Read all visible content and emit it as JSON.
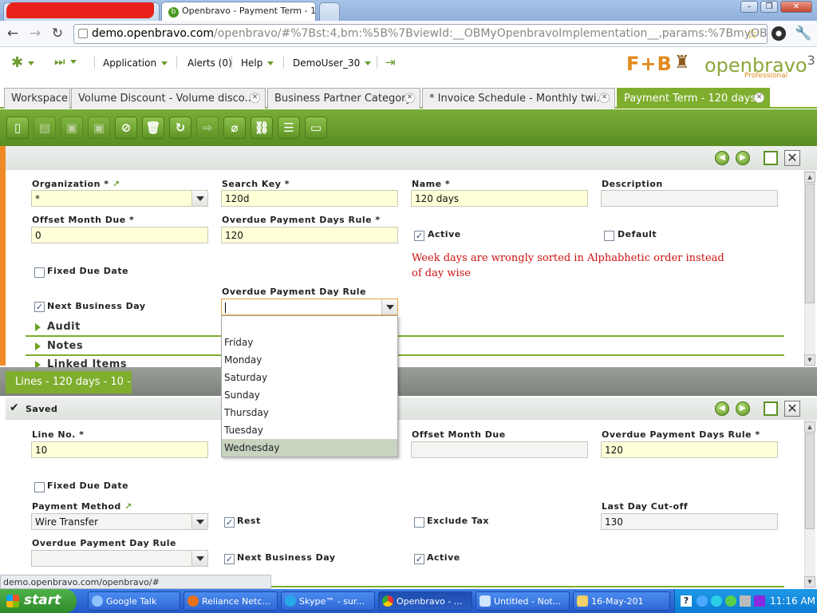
{
  "browser": {
    "active_tab_title": "Openbravo - Payment Term - 1",
    "url_host": "demo.openbravo.com",
    "url_rest": "/openbravo/#%7Bst:4,bm:%5B%7BviewId:__OBMyOpenbravoImplementation__,params:%7BmyOB:true,car"
  },
  "app_menu": {
    "application": "Application",
    "alerts": "Alerts (0)",
    "help": "Help",
    "user": "DemoUser_30"
  },
  "logo": {
    "brand1": "F+B",
    "brand2": "openbravo",
    "brand_sup": "3",
    "brand_sub": "Professional"
  },
  "app_tabs": [
    {
      "label": "Workspace"
    },
    {
      "label": "Volume Discount - Volume disco..."
    },
    {
      "label": "Business Partner Category"
    },
    {
      "label": "* Invoice Schedule - Monthly twi..."
    },
    {
      "label": "Payment Term - 120 days"
    }
  ],
  "header_form": {
    "organization": {
      "label": "Organization *",
      "value": "*"
    },
    "search_key": {
      "label": "Search Key *",
      "value": "120d"
    },
    "name": {
      "label": "Name *",
      "value": "120 days"
    },
    "description": {
      "label": "Description",
      "value": ""
    },
    "offset_month_due": {
      "label": "Offset Month Due *",
      "value": "0"
    },
    "overdue_payment_days_rule": {
      "label": "Overdue Payment Days Rule *",
      "value": "120"
    },
    "active": {
      "label": "Active",
      "checked": true
    },
    "default": {
      "label": "Default",
      "checked": false
    },
    "fixed_due_date": {
      "label": "Fixed Due Date",
      "checked": false
    },
    "next_business_day": {
      "label": "Next Business Day",
      "checked": true
    },
    "overdue_payment_day_rule": {
      "label": "Overdue Payment Day Rule",
      "value": ""
    },
    "annotation": "Week days are wrongly sorted in Alphabhetic order instead of day wise",
    "sections": [
      "Audit",
      "Notes",
      "Linked Items"
    ]
  },
  "dropdown": {
    "options": [
      "",
      "Friday",
      "Monday",
      "Saturday",
      "Sunday",
      "Thursday",
      "Tuesday",
      "Wednesday"
    ],
    "highlighted": "Wednesday"
  },
  "lines": {
    "tab_label": "Lines - 120 days - 10 -",
    "status": "Saved",
    "line_no": {
      "label": "Line No. *",
      "value": "10"
    },
    "offset_month_due": {
      "label": "Offset Month Due",
      "value": ""
    },
    "overdue_payment_days_rule": {
      "label": "Overdue Payment Days Rule *",
      "value": "120"
    },
    "fixed_due_date": {
      "label": "Fixed Due Date",
      "checked": false
    },
    "payment_method": {
      "label": "Payment Method",
      "value": "Wire Transfer"
    },
    "rest": {
      "label": "Rest",
      "checked": true
    },
    "exclude_tax": {
      "label": "Exclude Tax",
      "checked": false
    },
    "last_day_cutoff": {
      "label": "Last Day Cut-off",
      "value": "130"
    },
    "overdue_payment_day_rule": {
      "label": "Overdue Payment Day Rule",
      "value": ""
    },
    "next_business_day": {
      "label": "Next Business Day",
      "checked": true
    },
    "active": {
      "label": "Active",
      "checked": true
    }
  },
  "statusbar": {
    "text": "demo.openbravo.com/openbravo/#"
  },
  "taskbar": {
    "start": "start",
    "tasks": [
      "Google Talk",
      "Reliance Netc...",
      "Skype™ - sur...",
      "Openbravo - ...",
      "Untitled - Not...",
      "16-May-201"
    ],
    "clock": "11:16 AM"
  }
}
